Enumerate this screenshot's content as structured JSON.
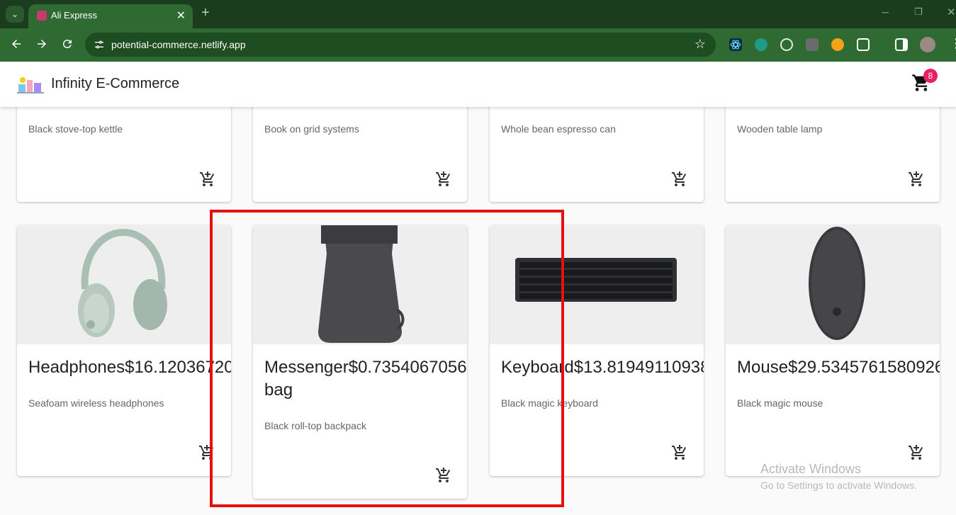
{
  "browser": {
    "tab_title": "Ali Express",
    "tab_close": "✕",
    "new_tab": "+",
    "url": "potential-commerce.netlify.app",
    "window_minimize": "─",
    "window_restore": "❐",
    "window_close": "✕"
  },
  "app": {
    "brand": "Infinity E-Commerce",
    "cart_count": "8"
  },
  "products_row1": [
    {
      "description": "Black stove-top kettle"
    },
    {
      "description": "Book on grid systems"
    },
    {
      "description": "Whole bean espresso can"
    },
    {
      "description": "Wooden table lamp"
    }
  ],
  "products_row2": [
    {
      "title": "Headphones$16.12036720",
      "description": "Seafoam wireless headphones"
    },
    {
      "title": "Messenger$0.7354067056 bag",
      "description": "Black roll-top backpack"
    },
    {
      "title": "Keyboard$13.81949110938",
      "description": "Black magic keyboard"
    },
    {
      "title": "Mouse$29.5345761580926",
      "description": "Black magic mouse"
    }
  ],
  "watermark": {
    "title": "Activate Windows",
    "subtitle": "Go to Settings to activate Windows."
  },
  "colors": {
    "tabbar": "#1b3d1e",
    "toolbar": "#2e6a32",
    "badge": "#e91e63",
    "highlight": "#e61010"
  }
}
